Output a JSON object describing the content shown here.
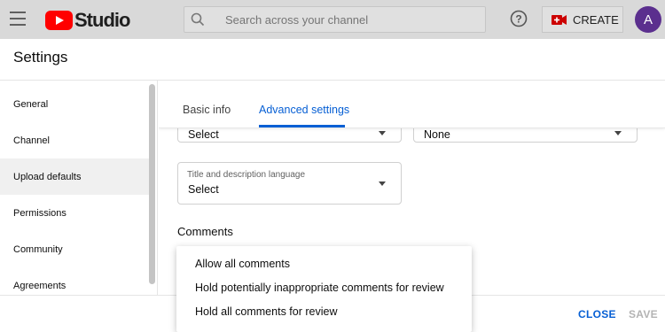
{
  "header": {
    "logo_text": "Studio",
    "search_placeholder": "Search across your channel",
    "create_label": "CREATE",
    "avatar_letter": "A"
  },
  "modal": {
    "title": "Settings",
    "sidebar": {
      "items": [
        {
          "label": "General",
          "active": false
        },
        {
          "label": "Channel",
          "active": false
        },
        {
          "label": "Upload defaults",
          "active": true
        },
        {
          "label": "Permissions",
          "active": false
        },
        {
          "label": "Community",
          "active": false
        },
        {
          "label": "Agreements",
          "active": false
        }
      ]
    },
    "tabs": [
      {
        "label": "Basic info",
        "active": false
      },
      {
        "label": "Advanced settings",
        "active": true
      }
    ],
    "fields": {
      "top_left_value": "Select",
      "top_right_value": "None",
      "language_label": "Title and description language",
      "language_value": "Select"
    },
    "comments_heading": "Comments",
    "comments_options": [
      "Allow all comments",
      "Hold potentially inappropriate comments for review",
      "Hold all comments for review"
    ],
    "footer": {
      "close_label": "CLOSE",
      "save_label": "SAVE"
    }
  },
  "colors": {
    "accent": "#065fd4",
    "brand_red": "#ff0000",
    "avatar_bg": "#5b2f8e"
  }
}
